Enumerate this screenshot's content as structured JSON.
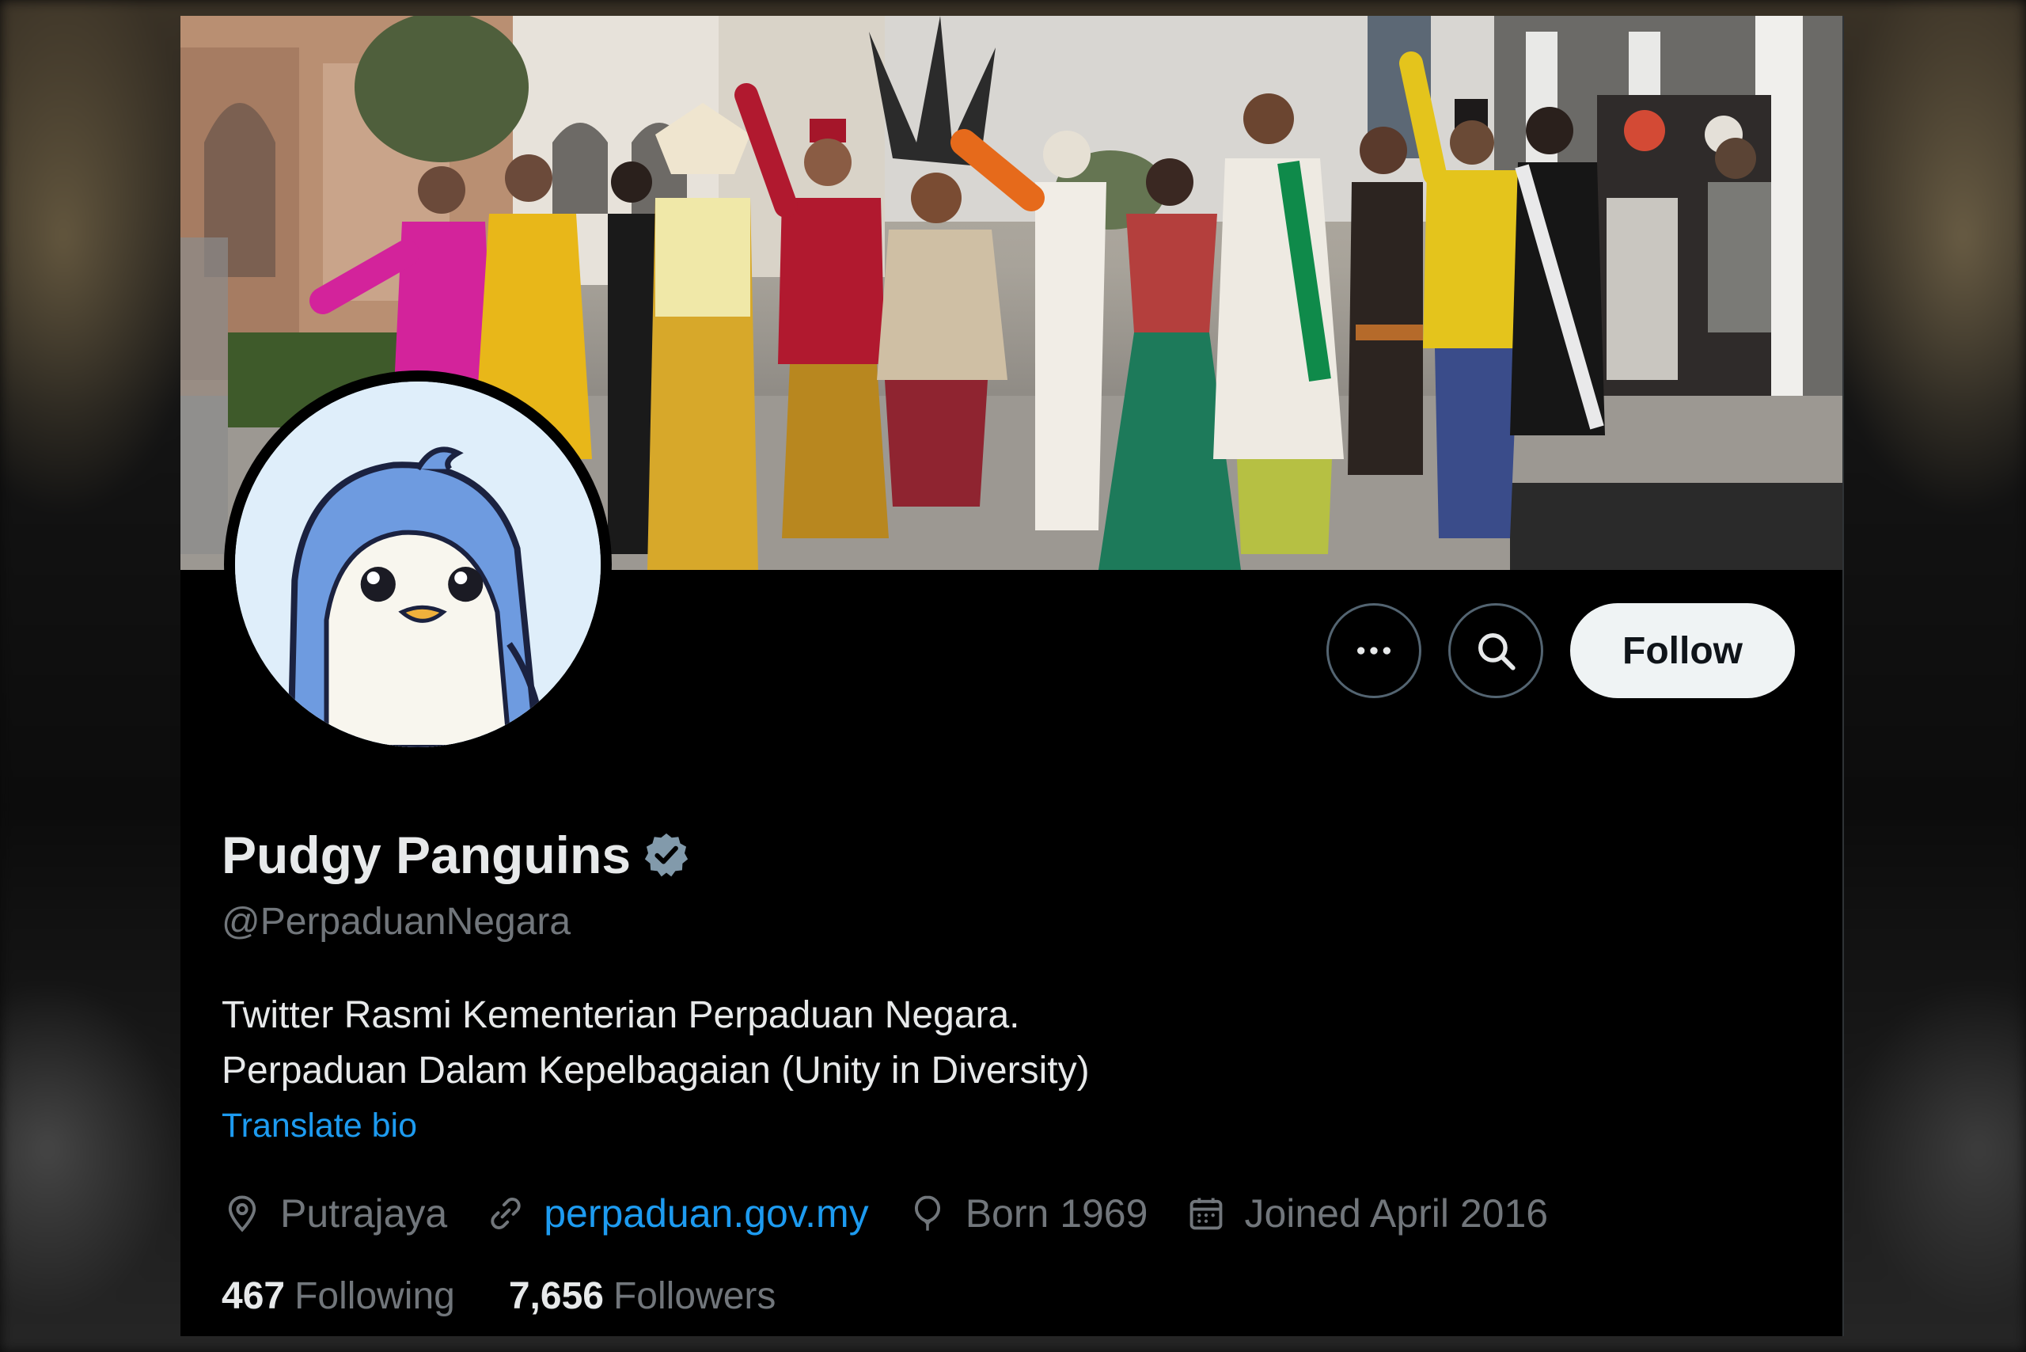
{
  "profile": {
    "display_name": "Pudgy Panguins",
    "handle": "@PerpaduanNegara",
    "bio_line1": "Twitter Rasmi Kementerian Perpaduan Negara.",
    "bio_line2": "Perpaduan Dalam Kepelbagaian (Unity in Diversity)",
    "translate_label": "Translate bio",
    "location": "Putrajaya",
    "website": "perpaduan.gov.my",
    "born": "Born 1969",
    "joined": "Joined April 2016",
    "following_count": "467",
    "following_label": "Following",
    "followers_count": "7,656",
    "followers_label": "Followers"
  },
  "actions": {
    "follow_label": "Follow",
    "more_icon": "more-horizontal-icon",
    "search_icon": "search-icon"
  },
  "colors": {
    "background": "#000000",
    "text_primary": "#e7e9ea",
    "text_secondary": "#71767b",
    "link": "#1d9bf0",
    "verified_badge": "#829aab",
    "follow_button_bg": "#eff3f4"
  },
  "icons": {
    "verified": "verified-badge-icon",
    "location": "location-pin-icon",
    "link": "link-icon",
    "born": "balloon-icon",
    "joined": "calendar-icon"
  }
}
